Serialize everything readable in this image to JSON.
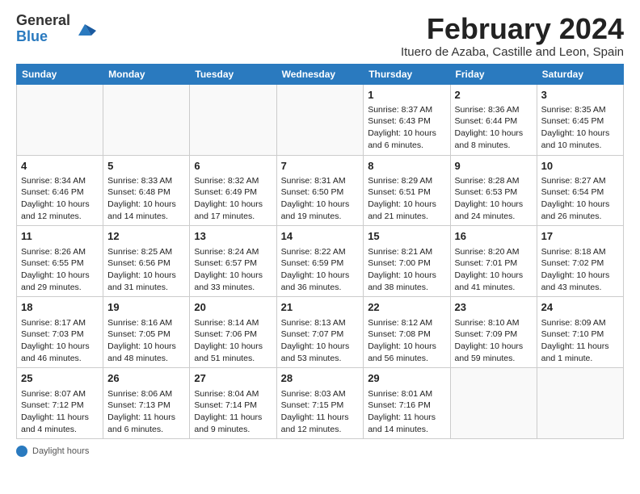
{
  "logo": {
    "general": "General",
    "blue": "Blue"
  },
  "title": "February 2024",
  "subtitle": "Ituero de Azaba, Castille and Leon, Spain",
  "days_of_week": [
    "Sunday",
    "Monday",
    "Tuesday",
    "Wednesday",
    "Thursday",
    "Friday",
    "Saturday"
  ],
  "footer": {
    "label": "Daylight hours"
  },
  "weeks": [
    [
      {
        "day": "",
        "info": ""
      },
      {
        "day": "",
        "info": ""
      },
      {
        "day": "",
        "info": ""
      },
      {
        "day": "",
        "info": ""
      },
      {
        "day": "1",
        "info": "Sunrise: 8:37 AM\nSunset: 6:43 PM\nDaylight: 10 hours and 6 minutes."
      },
      {
        "day": "2",
        "info": "Sunrise: 8:36 AM\nSunset: 6:44 PM\nDaylight: 10 hours and 8 minutes."
      },
      {
        "day": "3",
        "info": "Sunrise: 8:35 AM\nSunset: 6:45 PM\nDaylight: 10 hours and 10 minutes."
      }
    ],
    [
      {
        "day": "4",
        "info": "Sunrise: 8:34 AM\nSunset: 6:46 PM\nDaylight: 10 hours and 12 minutes."
      },
      {
        "day": "5",
        "info": "Sunrise: 8:33 AM\nSunset: 6:48 PM\nDaylight: 10 hours and 14 minutes."
      },
      {
        "day": "6",
        "info": "Sunrise: 8:32 AM\nSunset: 6:49 PM\nDaylight: 10 hours and 17 minutes."
      },
      {
        "day": "7",
        "info": "Sunrise: 8:31 AM\nSunset: 6:50 PM\nDaylight: 10 hours and 19 minutes."
      },
      {
        "day": "8",
        "info": "Sunrise: 8:29 AM\nSunset: 6:51 PM\nDaylight: 10 hours and 21 minutes."
      },
      {
        "day": "9",
        "info": "Sunrise: 8:28 AM\nSunset: 6:53 PM\nDaylight: 10 hours and 24 minutes."
      },
      {
        "day": "10",
        "info": "Sunrise: 8:27 AM\nSunset: 6:54 PM\nDaylight: 10 hours and 26 minutes."
      }
    ],
    [
      {
        "day": "11",
        "info": "Sunrise: 8:26 AM\nSunset: 6:55 PM\nDaylight: 10 hours and 29 minutes."
      },
      {
        "day": "12",
        "info": "Sunrise: 8:25 AM\nSunset: 6:56 PM\nDaylight: 10 hours and 31 minutes."
      },
      {
        "day": "13",
        "info": "Sunrise: 8:24 AM\nSunset: 6:57 PM\nDaylight: 10 hours and 33 minutes."
      },
      {
        "day": "14",
        "info": "Sunrise: 8:22 AM\nSunset: 6:59 PM\nDaylight: 10 hours and 36 minutes."
      },
      {
        "day": "15",
        "info": "Sunrise: 8:21 AM\nSunset: 7:00 PM\nDaylight: 10 hours and 38 minutes."
      },
      {
        "day": "16",
        "info": "Sunrise: 8:20 AM\nSunset: 7:01 PM\nDaylight: 10 hours and 41 minutes."
      },
      {
        "day": "17",
        "info": "Sunrise: 8:18 AM\nSunset: 7:02 PM\nDaylight: 10 hours and 43 minutes."
      }
    ],
    [
      {
        "day": "18",
        "info": "Sunrise: 8:17 AM\nSunset: 7:03 PM\nDaylight: 10 hours and 46 minutes."
      },
      {
        "day": "19",
        "info": "Sunrise: 8:16 AM\nSunset: 7:05 PM\nDaylight: 10 hours and 48 minutes."
      },
      {
        "day": "20",
        "info": "Sunrise: 8:14 AM\nSunset: 7:06 PM\nDaylight: 10 hours and 51 minutes."
      },
      {
        "day": "21",
        "info": "Sunrise: 8:13 AM\nSunset: 7:07 PM\nDaylight: 10 hours and 53 minutes."
      },
      {
        "day": "22",
        "info": "Sunrise: 8:12 AM\nSunset: 7:08 PM\nDaylight: 10 hours and 56 minutes."
      },
      {
        "day": "23",
        "info": "Sunrise: 8:10 AM\nSunset: 7:09 PM\nDaylight: 10 hours and 59 minutes."
      },
      {
        "day": "24",
        "info": "Sunrise: 8:09 AM\nSunset: 7:10 PM\nDaylight: 11 hours and 1 minute."
      }
    ],
    [
      {
        "day": "25",
        "info": "Sunrise: 8:07 AM\nSunset: 7:12 PM\nDaylight: 11 hours and 4 minutes."
      },
      {
        "day": "26",
        "info": "Sunrise: 8:06 AM\nSunset: 7:13 PM\nDaylight: 11 hours and 6 minutes."
      },
      {
        "day": "27",
        "info": "Sunrise: 8:04 AM\nSunset: 7:14 PM\nDaylight: 11 hours and 9 minutes."
      },
      {
        "day": "28",
        "info": "Sunrise: 8:03 AM\nSunset: 7:15 PM\nDaylight: 11 hours and 12 minutes."
      },
      {
        "day": "29",
        "info": "Sunrise: 8:01 AM\nSunset: 7:16 PM\nDaylight: 11 hours and 14 minutes."
      },
      {
        "day": "",
        "info": ""
      },
      {
        "day": "",
        "info": ""
      }
    ]
  ]
}
